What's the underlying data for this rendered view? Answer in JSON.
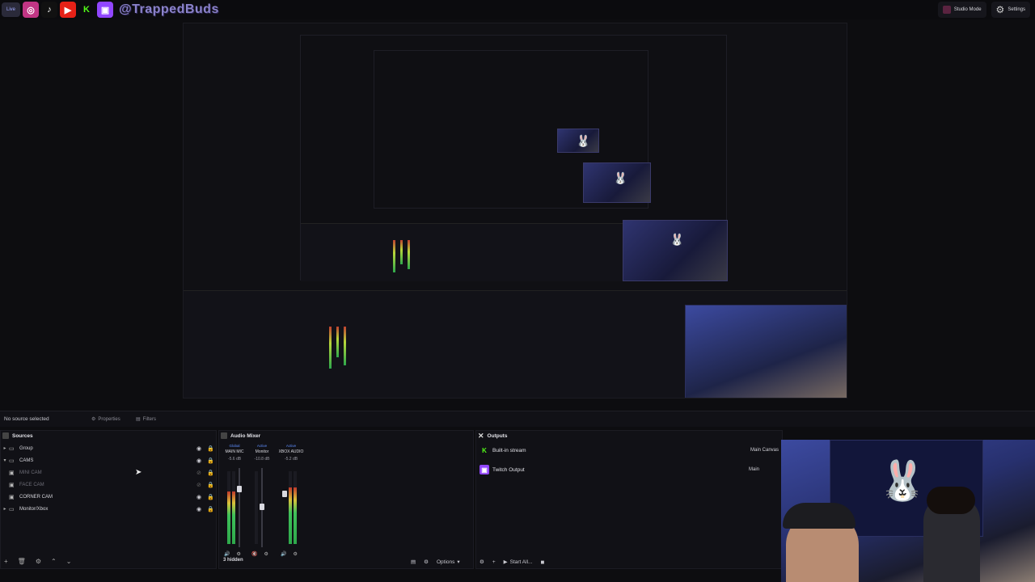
{
  "topbar": {
    "live_label": "Live",
    "handle": "@TrappedBuds",
    "studio_mode_label": "Studio Mode",
    "settings_label": "Settings",
    "socials": [
      {
        "icon": "instagram-icon",
        "color": "#c13584",
        "glyph": "◎"
      },
      {
        "icon": "tiktok-icon",
        "color": "#111111",
        "glyph": "♪"
      },
      {
        "icon": "youtube-icon",
        "color": "#e62117",
        "glyph": "▶"
      },
      {
        "icon": "kick-icon",
        "color": "#53fc18",
        "glyph": "K"
      },
      {
        "icon": "twitch-icon",
        "color": "#9146ff",
        "glyph": "▣"
      }
    ]
  },
  "context_bar": {
    "no_source": "No source selected",
    "properties_label": "Properties",
    "filters_label": "Filters"
  },
  "sources": {
    "title": "Sources",
    "items": [
      {
        "label": "Group",
        "expanded": false,
        "dim": false
      },
      {
        "label": "CAMS",
        "expanded": true,
        "dim": false
      },
      {
        "label": "MINI CAM",
        "expanded": false,
        "dim": true
      },
      {
        "label": "FACE CAM",
        "expanded": false,
        "dim": true
      },
      {
        "label": "CORNER CAM",
        "expanded": false,
        "dim": false
      },
      {
        "label": "Monitor/Xbox",
        "expanded": false,
        "dim": false
      }
    ]
  },
  "mixer": {
    "title": "Audio Mixer",
    "hidden_label": "3 hidden",
    "channels": [
      {
        "tag": "Global",
        "name": "MAIN MIC",
        "db": "-5.6 dB",
        "level": 0.72
      },
      {
        "tag": "Active",
        "name": "Monitor",
        "db": "-10.8 dB",
        "level": 0.0
      },
      {
        "tag": "Active",
        "name": "XBOX AUDIO",
        "db": "-5.2 dB",
        "level": 0.78
      }
    ],
    "options_label": "Options"
  },
  "outputs": {
    "title": "Outputs",
    "items": [
      {
        "label": "Built-in stream",
        "target": "Main Canvas",
        "icon": "kick-icon",
        "color": "#53fc18",
        "glyph": "K"
      },
      {
        "label": "Twitch Output",
        "target": "Main",
        "icon": "twitch-icon",
        "color": "#9146ff",
        "glyph": "▣"
      }
    ],
    "start_all_label": "Start All..."
  }
}
